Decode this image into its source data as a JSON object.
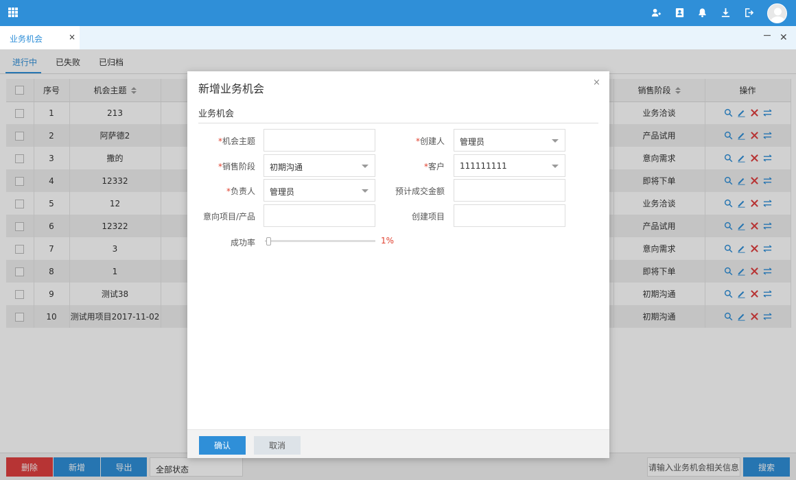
{
  "tabs": {
    "active_label": "业务机会",
    "close_glyph": "×"
  },
  "window": {
    "close_glyph": "✕"
  },
  "subtabs": [
    {
      "label": "进行中",
      "active": true
    },
    {
      "label": "已失败",
      "active": false
    },
    {
      "label": "已归档",
      "active": false
    }
  ],
  "table": {
    "headers": {
      "index": "序号",
      "subject": "机会主题",
      "stage": "销售阶段",
      "actions": "操作"
    },
    "rows": [
      {
        "index": "1",
        "subject": "213",
        "stage": "业务洽谈"
      },
      {
        "index": "2",
        "subject": "阿萨德2",
        "stage": "产品试用"
      },
      {
        "index": "3",
        "subject": "撒的",
        "stage": "意向需求"
      },
      {
        "index": "4",
        "subject": "12332",
        "stage": "即将下单"
      },
      {
        "index": "5",
        "subject": "12",
        "stage": "业务洽谈"
      },
      {
        "index": "6",
        "subject": "12322",
        "stage": "产品试用"
      },
      {
        "index": "7",
        "subject": "3",
        "stage": "意向需求"
      },
      {
        "index": "8",
        "subject": "1",
        "stage": "即将下单"
      },
      {
        "index": "9",
        "subject": "测试38",
        "stage": "初期沟通"
      },
      {
        "index": "10",
        "subject": "测试用项目2017-11-02",
        "stage": "初期沟通"
      }
    ]
  },
  "bottom": {
    "delete": "删除",
    "add": "新增",
    "export": "导出",
    "status_select": "全部状态",
    "search_placeholder": "请输入业务机会相关信息",
    "search": "搜索"
  },
  "modal": {
    "title": "新增业务机会",
    "close_glyph": "×",
    "section": "业务机会",
    "required_mark": "*",
    "labels": {
      "subject": "机会主题",
      "creator": "创建人",
      "stage": "销售阶段",
      "customer": "客户",
      "owner": "负责人",
      "expected_amount": "预计成交金额",
      "product": "意向项目/产品",
      "create_project": "创建项目",
      "success_rate": "成功率"
    },
    "values": {
      "subject": "",
      "creator": "管理员",
      "stage": "初期沟通",
      "customer": "111111111",
      "owner": "管理员",
      "expected_amount": "",
      "product": "",
      "create_project": ""
    },
    "success_rate": {
      "value": 1,
      "label": "1%"
    },
    "confirm": "确认",
    "cancel": "取消"
  },
  "colors": {
    "primary": "#2f8fd8",
    "danger": "#e04040",
    "required": "#e0402f"
  }
}
